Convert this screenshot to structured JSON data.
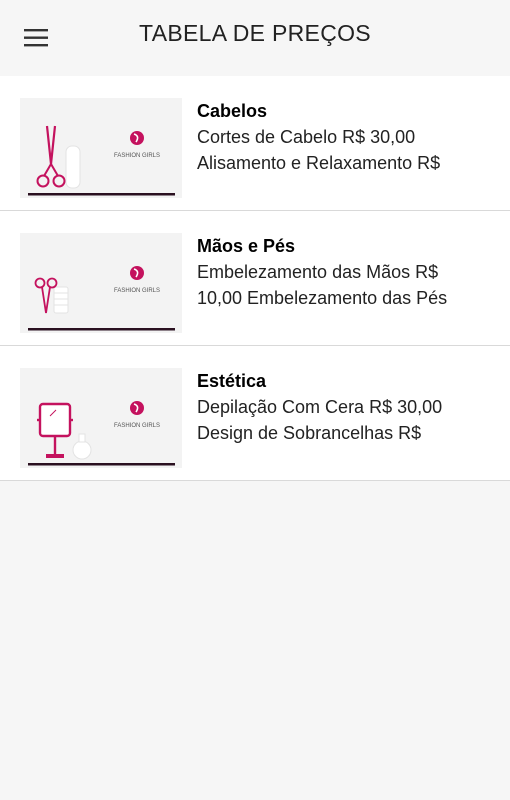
{
  "appbar": {
    "title": "TABELA DE PREÇOS",
    "menu_icon": "hamburger-menu-icon"
  },
  "colors": {
    "brand_pink": "#c4125e",
    "divider": "#d9d9d9"
  },
  "items": [
    {
      "title": "Cabelos",
      "description": "Cortes de Cabelo R$ 30,00 Alisamento e Relaxamento R$",
      "image_icon": "scissors-comb-icon",
      "brand_text": "FASHION GIRLS"
    },
    {
      "title": "Mãos e Pés",
      "description": "Embelezamento das Mãos R$ 10,00 Embelezamento das Pés",
      "image_icon": "nail-scissors-icon",
      "brand_text": "FASHION GIRLS"
    },
    {
      "title": "Estética",
      "description": "Depilação Com Cera R$ 30,00 Design de Sobrancelhas R$",
      "image_icon": "mirror-icon",
      "brand_text": "FASHION GIRLS"
    }
  ]
}
